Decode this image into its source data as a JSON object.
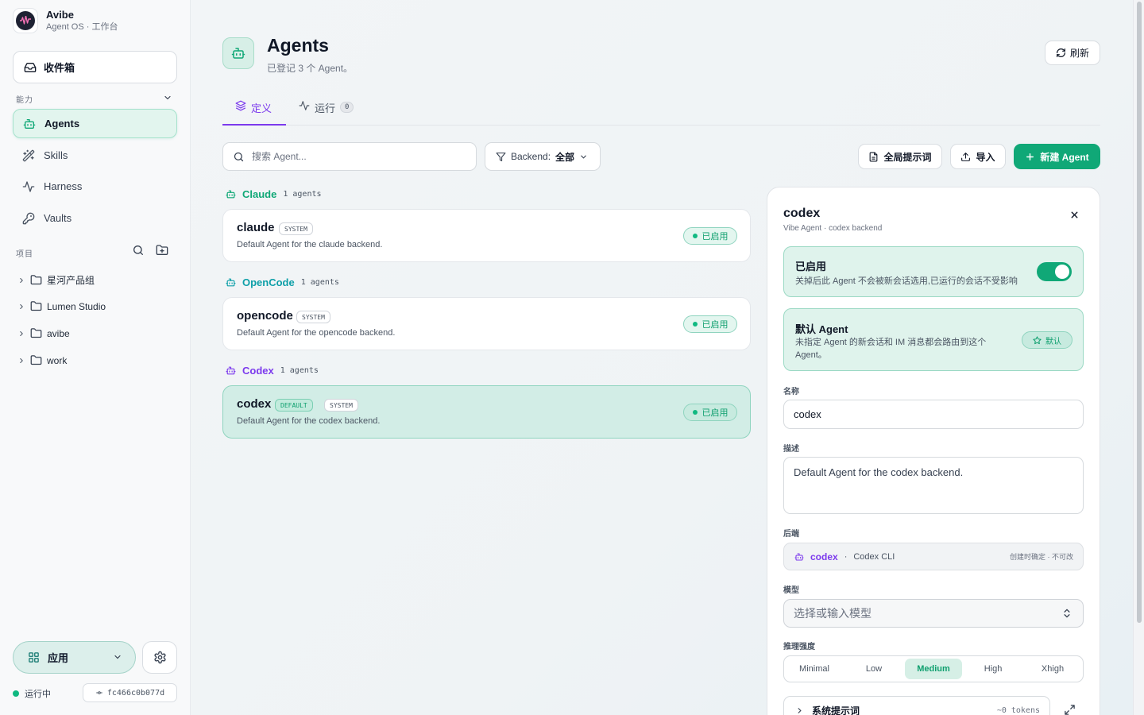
{
  "app": {
    "name": "Avibe",
    "subtitle": "Agent OS · 工作台"
  },
  "sidebar": {
    "inbox_label": "收件箱",
    "capability_section": "能力",
    "nav": [
      {
        "label": "Agents",
        "icon": "robot-icon",
        "active": true
      },
      {
        "label": "Skills",
        "icon": "wand-icon",
        "active": false
      },
      {
        "label": "Harness",
        "icon": "activity-icon",
        "active": false
      },
      {
        "label": "Vaults",
        "icon": "key-icon",
        "active": false
      }
    ],
    "projects_section": "项目",
    "projects": [
      {
        "label": "星河产品组"
      },
      {
        "label": "Lumen Studio"
      },
      {
        "label": "avibe"
      },
      {
        "label": "work"
      }
    ],
    "apps_label": "应用",
    "status_text": "运行中",
    "commit": "fc466c0b077d"
  },
  "header": {
    "title": "Agents",
    "subtitle": "已登记 3 个 Agent。",
    "refresh_label": "刷新"
  },
  "tabs": [
    {
      "label": "定义",
      "active": true
    },
    {
      "label": "运行",
      "count": "0",
      "active": false
    }
  ],
  "toolbar": {
    "search_placeholder": "搜索 Agent...",
    "filter_label": "Backend:",
    "filter_value": "全部",
    "global_prompt_label": "全局提示词",
    "import_label": "导入",
    "new_agent_label": "新建 Agent"
  },
  "groups": [
    {
      "name": "Claude",
      "count": "1 agents",
      "color": "#10a877",
      "agents": [
        {
          "name": "claude",
          "badges": [
            "SYSTEM"
          ],
          "description": "Default Agent for the claude backend.",
          "status": "已启用"
        }
      ]
    },
    {
      "name": "OpenCode",
      "count": "1 agents",
      "color": "#0e9fa8",
      "agents": [
        {
          "name": "opencode",
          "badges": [
            "SYSTEM"
          ],
          "description": "Default Agent for the opencode backend.",
          "status": "已启用"
        }
      ]
    },
    {
      "name": "Codex",
      "count": "1 agents",
      "color": "#7c3aed",
      "agents": [
        {
          "name": "codex",
          "badges": [
            "DEFAULT",
            "SYSTEM"
          ],
          "description": "Default Agent for the codex backend.",
          "status": "已启用",
          "selected": true
        }
      ]
    }
  ],
  "detail": {
    "title": "codex",
    "subtitle": "Vibe Agent · codex backend",
    "enabled": {
      "title": "已启用",
      "desc": "关掉后此 Agent 不会被新会话选用,已运行的会话不受影响",
      "on": true
    },
    "default": {
      "title": "默认 Agent",
      "desc": "未指定 Agent 的新会话和 IM 消息都会路由到这个 Agent。",
      "chip": "默认"
    },
    "name_label": "名称",
    "name_value": "codex",
    "desc_label": "描述",
    "desc_value": "Default Agent for the codex backend.",
    "backend_label": "后端",
    "backend_name": "codex",
    "backend_sep": "·",
    "backend_cli": "Codex CLI",
    "backend_note": "创建时确定 · 不可改",
    "model_label": "模型",
    "model_placeholder": "选择或输入模型",
    "effort_label": "推理强度",
    "effort_options": [
      "Minimal",
      "Low",
      "Medium",
      "High",
      "Xhigh"
    ],
    "effort_selected": "Medium",
    "system_prompt_label": "系统提示词",
    "system_prompt_tokens": "~0 tokens"
  },
  "colors": {
    "accent": "#10a877",
    "purple": "#7c3aed",
    "active_bg": "#e2f5ee"
  }
}
